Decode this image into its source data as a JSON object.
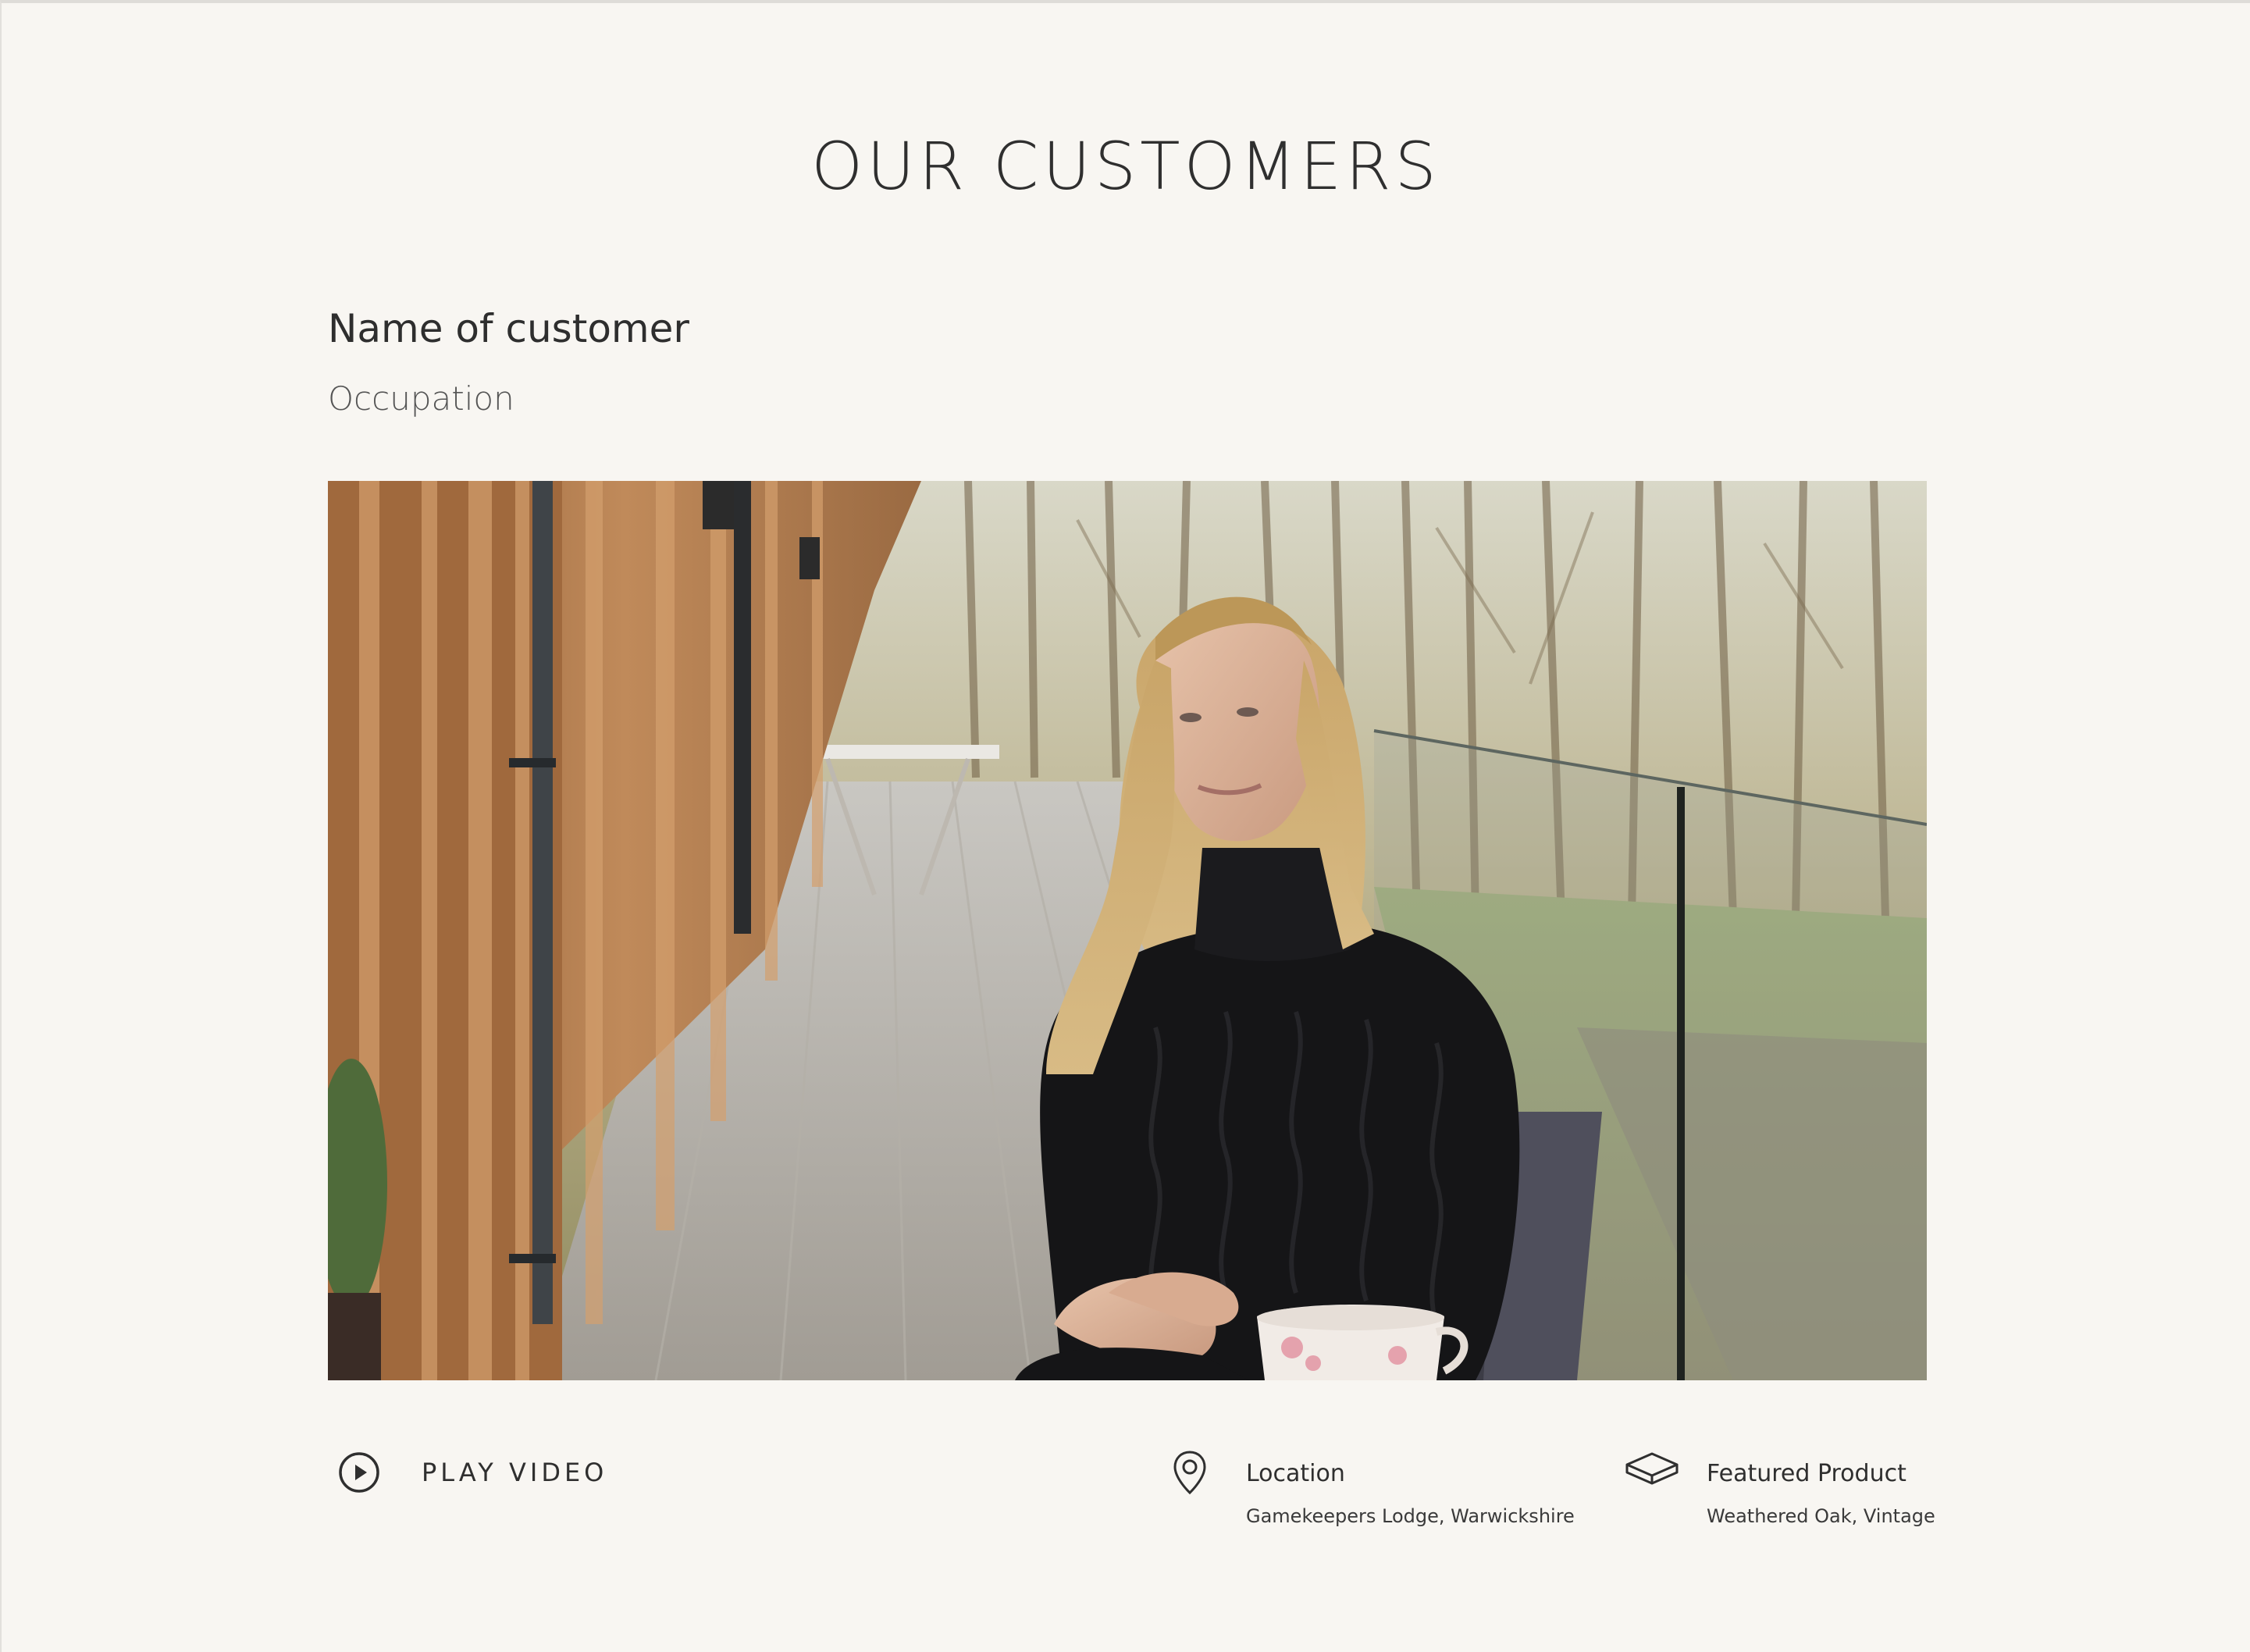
{
  "section": {
    "title": "OUR CUSTOMERS"
  },
  "customer": {
    "name": "Name of customer",
    "occupation": "Occupation"
  },
  "video": {
    "play_label": "PLAY VIDEO",
    "play_icon": "play-circle-icon"
  },
  "details": {
    "location": {
      "icon": "map-pin-icon",
      "title": "Location",
      "value": "Gamekeepers Lodge, Warwickshire"
    },
    "product": {
      "icon": "floor-plank-icon",
      "title": "Featured Product",
      "value": "Weathered Oak, Vintage"
    }
  },
  "colors": {
    "background": "#f8f6f2",
    "text": "#2f2f2f"
  }
}
